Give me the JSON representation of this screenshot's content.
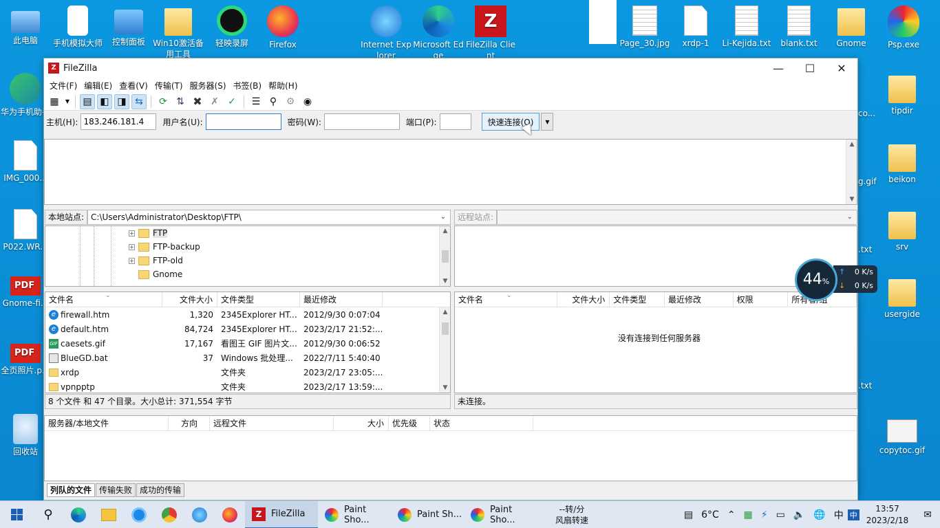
{
  "desktop": {
    "left_icons": [
      {
        "label": "此电脑",
        "type": "pc"
      },
      {
        "label": "手机模拟大师",
        "type": "app"
      },
      {
        "label": "控制面板",
        "type": "app"
      },
      {
        "label": "Win10激活备用工具",
        "type": "app"
      },
      {
        "label": "轻映录屏",
        "type": "app"
      },
      {
        "label": "Firefox",
        "type": "app"
      },
      {
        "label": "华为手机助手",
        "type": "app"
      },
      {
        "label": "IMG_000...",
        "type": "doc"
      },
      {
        "label": "P022.WR...",
        "type": "doc"
      },
      {
        "label": "Gnome-fi...",
        "type": "pdf"
      },
      {
        "label": "全页照片.p...",
        "type": "pdf"
      },
      {
        "label": "回收站",
        "type": "recycle"
      }
    ],
    "top_icons": [
      {
        "label": "Internet Explorer",
        "type": "app"
      },
      {
        "label": "Microsoft Edge",
        "type": "app"
      },
      {
        "label": "FileZilla Client",
        "type": "fz"
      },
      {
        "label": "Page_30.jpg",
        "type": "doc"
      },
      {
        "label": "xrdp-1",
        "type": "doc"
      },
      {
        "label": "Li-Kejida.txt",
        "type": "txt"
      },
      {
        "label": "blank.txt",
        "type": "txt"
      },
      {
        "label": "Gnome",
        "type": "folder"
      },
      {
        "label": "Psp.exe",
        "type": "app"
      }
    ],
    "right_icons": [
      {
        "label": "tipdir",
        "type": "folder"
      },
      {
        "label": "beikon",
        "type": "folder"
      },
      {
        "label": "srv",
        "type": "folder"
      },
      {
        "label": "usergide",
        "type": "folder"
      },
      {
        "label": "copytoc.gif",
        "type": "doc"
      }
    ],
    "partial_labels": [
      "co...",
      "g.gif",
      ".txt",
      ".txt"
    ]
  },
  "window": {
    "title": "FileZilla",
    "menu": [
      "文件(F)",
      "编辑(E)",
      "查看(V)",
      "传输(T)",
      "服务器(S)",
      "书签(B)",
      "帮助(H)"
    ],
    "quickconnect": {
      "host_label": "主机(H):",
      "host_value": "183.246.181.4",
      "user_label": "用户名(U):",
      "user_value": "",
      "pass_label": "密码(W):",
      "pass_value": "",
      "port_label": "端口(P):",
      "port_value": "",
      "connect_label": "快速连接(Q)"
    },
    "local": {
      "site_label": "本地站点:",
      "path": "C:\\Users\\Administrator\\Desktop\\FTP\\",
      "tree": [
        {
          "name": "FTP",
          "selected": true
        },
        {
          "name": "FTP-backup",
          "selected": false
        },
        {
          "name": "FTP-old",
          "selected": false
        },
        {
          "name": "Gnome",
          "selected": false
        }
      ],
      "columns": [
        "文件名",
        "文件大小",
        "文件类型",
        "最近修改"
      ],
      "files": [
        {
          "name": "firewall.htm",
          "size": "1,320",
          "type": "2345Explorer HT...",
          "modified": "2012/9/30 0:07:04",
          "icon": "htm"
        },
        {
          "name": "default.htm",
          "size": "84,724",
          "type": "2345Explorer HT...",
          "modified": "2023/2/17 21:52:...",
          "icon": "htm"
        },
        {
          "name": "caesets.gif",
          "size": "17,167",
          "type": "看图王 GIF 图片文...",
          "modified": "2012/9/30 0:06:52",
          "icon": "gif"
        },
        {
          "name": "BlueGD.bat",
          "size": "37",
          "type": "Windows 批处理...",
          "modified": "2022/7/11 5:40:40",
          "icon": "bat"
        },
        {
          "name": "xrdp",
          "size": "",
          "type": "文件夹",
          "modified": "2023/2/17 23:05:...",
          "icon": "folder"
        },
        {
          "name": "vpnpptp",
          "size": "",
          "type": "文件夹",
          "modified": "2023/2/17 13:59:...",
          "icon": "folder"
        }
      ],
      "status": "8 个文件 和 47 个目录。大小总计: 371,554 字节"
    },
    "remote": {
      "site_label": "远程站点:",
      "path": "",
      "columns": [
        "文件名",
        "文件大小",
        "文件类型",
        "最近修改",
        "权限",
        "所有者/组"
      ],
      "empty_message": "没有连接到任何服务器",
      "status": "未连接。"
    },
    "queue": {
      "columns": [
        "服务器/本地文件",
        "方向",
        "远程文件",
        "大小",
        "优先级",
        "状态"
      ],
      "tabs": [
        "列队的文件",
        "传输失败",
        "成功的传输"
      ]
    }
  },
  "netmeter": {
    "percent": "44",
    "unit": "%",
    "up": "0",
    "down": "0",
    "rate_unit": "K/s"
  },
  "taskbar": {
    "apps": [
      "FileZilla",
      "Paint Sho...",
      "Paint Sh...",
      "Paint Sho..."
    ],
    "fan_line1": "--转/分",
    "fan_line2": "风扇转速",
    "weather": "6°C",
    "ime": "中",
    "time": "13:57",
    "date": "2023/2/18"
  }
}
